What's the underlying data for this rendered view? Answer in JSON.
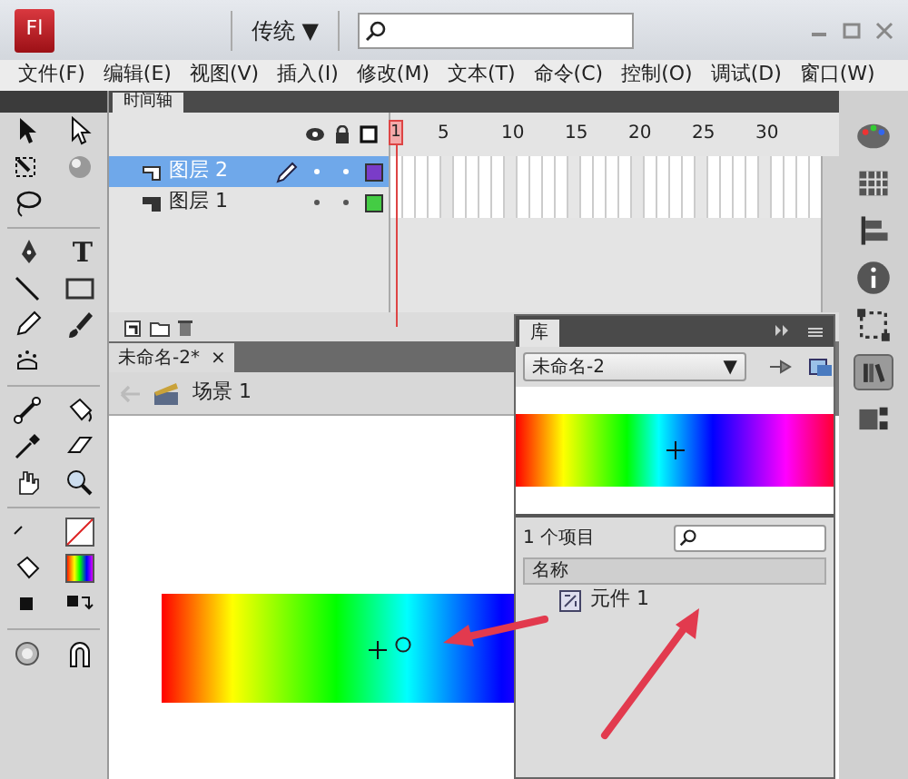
{
  "app": {
    "logo": "Fl",
    "workspace": "传统",
    "workspace_caret": "▼"
  },
  "menu": [
    "文件(F)",
    "编辑(E)",
    "视图(V)",
    "插入(I)",
    "修改(M)",
    "文本(T)",
    "命令(C)",
    "控制(O)",
    "调试(D)",
    "窗口(W)"
  ],
  "tools": {
    "text_tool": "T"
  },
  "timeline": {
    "tab": "时间轴",
    "frame_numbers": [
      "1",
      "5",
      "10",
      "15",
      "20",
      "25",
      "30"
    ],
    "layers": [
      {
        "name": "图层 2",
        "selected": true,
        "editing": true,
        "color": "#7a3cc8"
      },
      {
        "name": "图层 1",
        "selected": false,
        "editing": false,
        "color": "#44cc44"
      }
    ]
  },
  "document": {
    "tab": "未命名-2*",
    "close": "×",
    "scene": "场景 1"
  },
  "library": {
    "tab": "库",
    "document": "未命名-2",
    "item_count": "1 个项目",
    "column": "名称",
    "items": [
      {
        "name": "元件 1"
      }
    ]
  }
}
